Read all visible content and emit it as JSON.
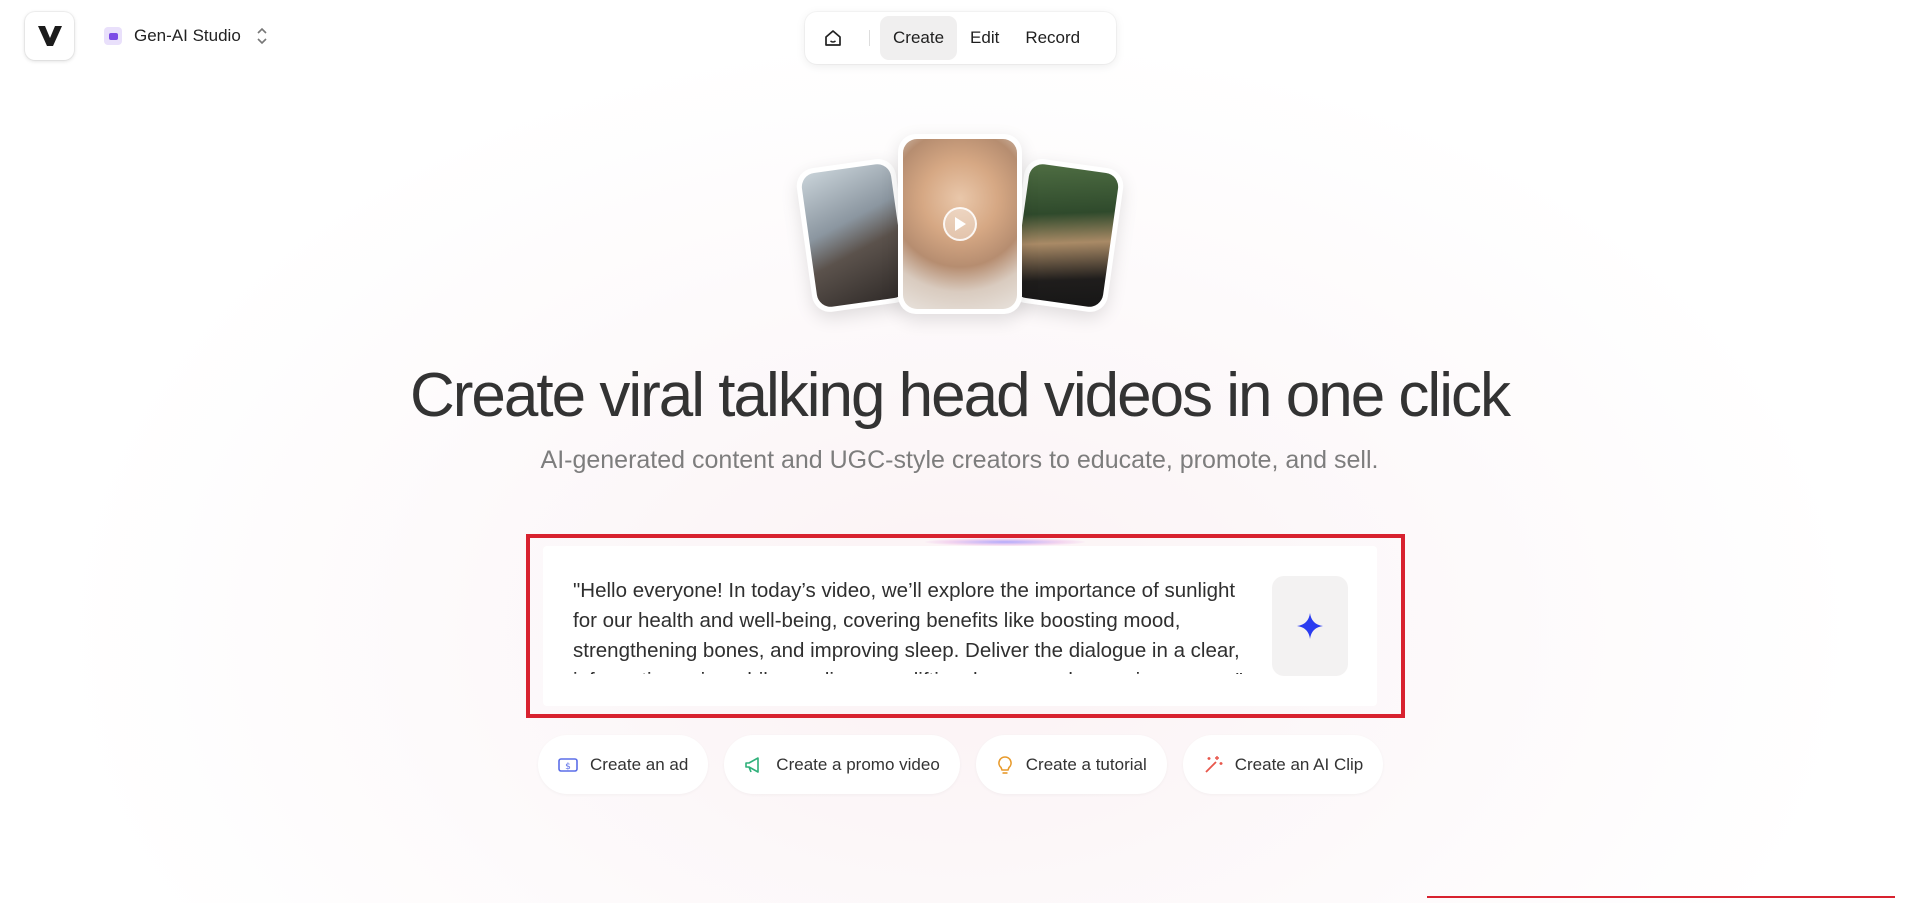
{
  "brand": {
    "logo_letter": "V"
  },
  "workspace": {
    "name": "Gen-AI Studio"
  },
  "topnav": {
    "tabs": [
      {
        "label": "Create",
        "active": true
      },
      {
        "label": "Edit",
        "active": false
      },
      {
        "label": "Record",
        "active": false
      }
    ]
  },
  "hero": {
    "title": "Create viral talking head videos in one click",
    "subtitle": "AI-generated content and UGC-style creators to educate, promote, and sell."
  },
  "prompt": {
    "value": "\"Hello everyone! In today’s video, we’ll explore the importance of sunlight for our health and well-being, covering benefits like boosting mood, strengthening bones, and improving sleep. Deliver the dialogue in a clear, informative voice while exuding an uplifting, happy, and engaging energy.\""
  },
  "actions": [
    {
      "label": "Create an ad",
      "icon": "dollar-bill-icon",
      "color": "#5b6ee8"
    },
    {
      "label": "Create a promo video",
      "icon": "megaphone-icon",
      "color": "#2fb07a"
    },
    {
      "label": "Create a tutorial",
      "icon": "lightbulb-icon",
      "color": "#e89a2b"
    },
    {
      "label": "Create an AI Clip",
      "icon": "magic-wand-icon",
      "color": "#e8564b"
    }
  ],
  "colors": {
    "accent_red": "#d8222f",
    "sparkle_blue": "#2a3cf0",
    "workspace_purple": "#7b4be6"
  }
}
